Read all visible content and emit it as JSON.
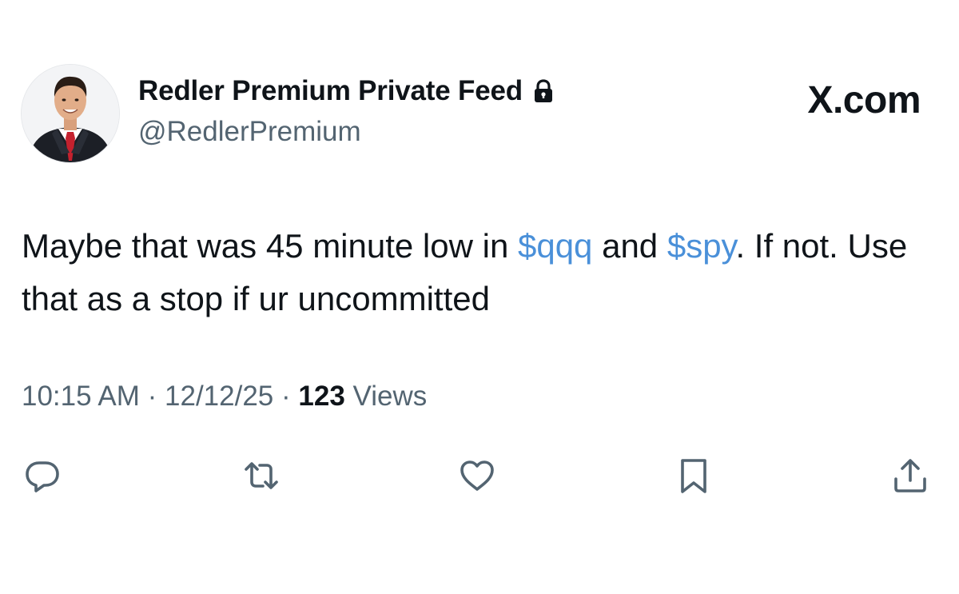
{
  "header": {
    "display_name": "Redler Premium Private Feed",
    "handle": "@RedlerPremium",
    "brand": "X.com",
    "avatar_icon": "profile-photo",
    "protected_icon": "lock-icon"
  },
  "tweet": {
    "text_part1": "Maybe that was 45 minute low in ",
    "cashtag1": "$qqq",
    "text_part2": " and ",
    "cashtag2": "$spy",
    "text_part3": ".  If not. Use that as a stop if ur uncommitted"
  },
  "meta": {
    "time": "10:15 AM",
    "separator": "·",
    "date": "12/12/25",
    "views_count": "123",
    "views_label": "Views"
  },
  "actions": [
    {
      "name": "reply",
      "icon": "reply-icon"
    },
    {
      "name": "repost",
      "icon": "repost-icon"
    },
    {
      "name": "like",
      "icon": "heart-icon"
    },
    {
      "name": "bookmark",
      "icon": "bookmark-icon"
    },
    {
      "name": "share",
      "icon": "share-icon"
    }
  ],
  "colors": {
    "text": "#0f1419",
    "secondary": "#536471",
    "link": "#4a90d9",
    "background": "#ffffff"
  }
}
